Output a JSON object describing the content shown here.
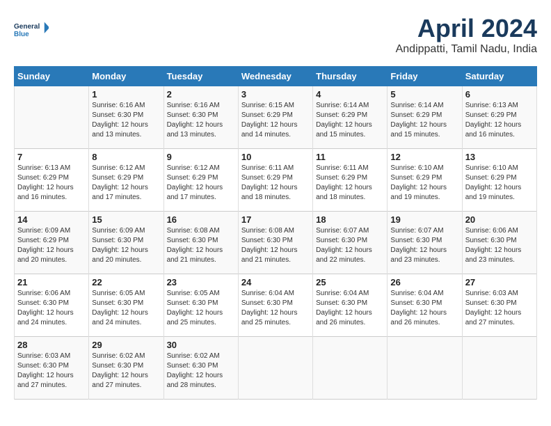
{
  "header": {
    "logo_line1": "General",
    "logo_line2": "Blue",
    "month": "April 2024",
    "location": "Andippatti, Tamil Nadu, India"
  },
  "days_of_week": [
    "Sunday",
    "Monday",
    "Tuesday",
    "Wednesday",
    "Thursday",
    "Friday",
    "Saturday"
  ],
  "weeks": [
    [
      {
        "num": "",
        "sunrise": "",
        "sunset": "",
        "daylight": ""
      },
      {
        "num": "1",
        "sunrise": "Sunrise: 6:16 AM",
        "sunset": "Sunset: 6:30 PM",
        "daylight": "Daylight: 12 hours and 13 minutes."
      },
      {
        "num": "2",
        "sunrise": "Sunrise: 6:16 AM",
        "sunset": "Sunset: 6:30 PM",
        "daylight": "Daylight: 12 hours and 13 minutes."
      },
      {
        "num": "3",
        "sunrise": "Sunrise: 6:15 AM",
        "sunset": "Sunset: 6:29 PM",
        "daylight": "Daylight: 12 hours and 14 minutes."
      },
      {
        "num": "4",
        "sunrise": "Sunrise: 6:14 AM",
        "sunset": "Sunset: 6:29 PM",
        "daylight": "Daylight: 12 hours and 15 minutes."
      },
      {
        "num": "5",
        "sunrise": "Sunrise: 6:14 AM",
        "sunset": "Sunset: 6:29 PM",
        "daylight": "Daylight: 12 hours and 15 minutes."
      },
      {
        "num": "6",
        "sunrise": "Sunrise: 6:13 AM",
        "sunset": "Sunset: 6:29 PM",
        "daylight": "Daylight: 12 hours and 16 minutes."
      }
    ],
    [
      {
        "num": "7",
        "sunrise": "Sunrise: 6:13 AM",
        "sunset": "Sunset: 6:29 PM",
        "daylight": "Daylight: 12 hours and 16 minutes."
      },
      {
        "num": "8",
        "sunrise": "Sunrise: 6:12 AM",
        "sunset": "Sunset: 6:29 PM",
        "daylight": "Daylight: 12 hours and 17 minutes."
      },
      {
        "num": "9",
        "sunrise": "Sunrise: 6:12 AM",
        "sunset": "Sunset: 6:29 PM",
        "daylight": "Daylight: 12 hours and 17 minutes."
      },
      {
        "num": "10",
        "sunrise": "Sunrise: 6:11 AM",
        "sunset": "Sunset: 6:29 PM",
        "daylight": "Daylight: 12 hours and 18 minutes."
      },
      {
        "num": "11",
        "sunrise": "Sunrise: 6:11 AM",
        "sunset": "Sunset: 6:29 PM",
        "daylight": "Daylight: 12 hours and 18 minutes."
      },
      {
        "num": "12",
        "sunrise": "Sunrise: 6:10 AM",
        "sunset": "Sunset: 6:29 PM",
        "daylight": "Daylight: 12 hours and 19 minutes."
      },
      {
        "num": "13",
        "sunrise": "Sunrise: 6:10 AM",
        "sunset": "Sunset: 6:29 PM",
        "daylight": "Daylight: 12 hours and 19 minutes."
      }
    ],
    [
      {
        "num": "14",
        "sunrise": "Sunrise: 6:09 AM",
        "sunset": "Sunset: 6:29 PM",
        "daylight": "Daylight: 12 hours and 20 minutes."
      },
      {
        "num": "15",
        "sunrise": "Sunrise: 6:09 AM",
        "sunset": "Sunset: 6:30 PM",
        "daylight": "Daylight: 12 hours and 20 minutes."
      },
      {
        "num": "16",
        "sunrise": "Sunrise: 6:08 AM",
        "sunset": "Sunset: 6:30 PM",
        "daylight": "Daylight: 12 hours and 21 minutes."
      },
      {
        "num": "17",
        "sunrise": "Sunrise: 6:08 AM",
        "sunset": "Sunset: 6:30 PM",
        "daylight": "Daylight: 12 hours and 21 minutes."
      },
      {
        "num": "18",
        "sunrise": "Sunrise: 6:07 AM",
        "sunset": "Sunset: 6:30 PM",
        "daylight": "Daylight: 12 hours and 22 minutes."
      },
      {
        "num": "19",
        "sunrise": "Sunrise: 6:07 AM",
        "sunset": "Sunset: 6:30 PM",
        "daylight": "Daylight: 12 hours and 23 minutes."
      },
      {
        "num": "20",
        "sunrise": "Sunrise: 6:06 AM",
        "sunset": "Sunset: 6:30 PM",
        "daylight": "Daylight: 12 hours and 23 minutes."
      }
    ],
    [
      {
        "num": "21",
        "sunrise": "Sunrise: 6:06 AM",
        "sunset": "Sunset: 6:30 PM",
        "daylight": "Daylight: 12 hours and 24 minutes."
      },
      {
        "num": "22",
        "sunrise": "Sunrise: 6:05 AM",
        "sunset": "Sunset: 6:30 PM",
        "daylight": "Daylight: 12 hours and 24 minutes."
      },
      {
        "num": "23",
        "sunrise": "Sunrise: 6:05 AM",
        "sunset": "Sunset: 6:30 PM",
        "daylight": "Daylight: 12 hours and 25 minutes."
      },
      {
        "num": "24",
        "sunrise": "Sunrise: 6:04 AM",
        "sunset": "Sunset: 6:30 PM",
        "daylight": "Daylight: 12 hours and 25 minutes."
      },
      {
        "num": "25",
        "sunrise": "Sunrise: 6:04 AM",
        "sunset": "Sunset: 6:30 PM",
        "daylight": "Daylight: 12 hours and 26 minutes."
      },
      {
        "num": "26",
        "sunrise": "Sunrise: 6:04 AM",
        "sunset": "Sunset: 6:30 PM",
        "daylight": "Daylight: 12 hours and 26 minutes."
      },
      {
        "num": "27",
        "sunrise": "Sunrise: 6:03 AM",
        "sunset": "Sunset: 6:30 PM",
        "daylight": "Daylight: 12 hours and 27 minutes."
      }
    ],
    [
      {
        "num": "28",
        "sunrise": "Sunrise: 6:03 AM",
        "sunset": "Sunset: 6:30 PM",
        "daylight": "Daylight: 12 hours and 27 minutes."
      },
      {
        "num": "29",
        "sunrise": "Sunrise: 6:02 AM",
        "sunset": "Sunset: 6:30 PM",
        "daylight": "Daylight: 12 hours and 27 minutes."
      },
      {
        "num": "30",
        "sunrise": "Sunrise: 6:02 AM",
        "sunset": "Sunset: 6:30 PM",
        "daylight": "Daylight: 12 hours and 28 minutes."
      },
      {
        "num": "",
        "sunrise": "",
        "sunset": "",
        "daylight": ""
      },
      {
        "num": "",
        "sunrise": "",
        "sunset": "",
        "daylight": ""
      },
      {
        "num": "",
        "sunrise": "",
        "sunset": "",
        "daylight": ""
      },
      {
        "num": "",
        "sunrise": "",
        "sunset": "",
        "daylight": ""
      }
    ]
  ]
}
